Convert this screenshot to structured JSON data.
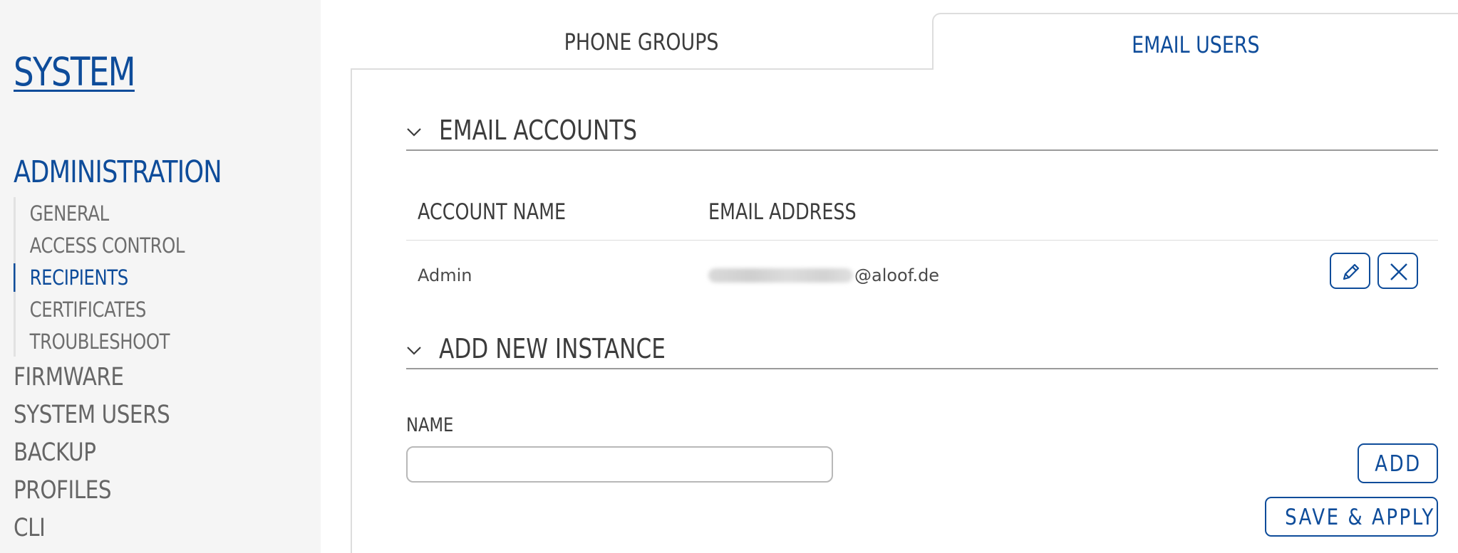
{
  "sidebar": {
    "title": "SYSTEM",
    "section": "ADMINISTRATION",
    "subitems": [
      {
        "label": "GENERAL",
        "active": false
      },
      {
        "label": "ACCESS CONTROL",
        "active": false
      },
      {
        "label": "RECIPIENTS",
        "active": true
      },
      {
        "label": "CERTIFICATES",
        "active": false
      },
      {
        "label": "TROUBLESHOOT",
        "active": false
      }
    ],
    "items": [
      {
        "label": "FIRMWARE"
      },
      {
        "label": "SYSTEM USERS"
      },
      {
        "label": "BACKUP"
      },
      {
        "label": "PROFILES"
      },
      {
        "label": "CLI"
      }
    ]
  },
  "tabs": [
    {
      "label": "PHONE GROUPS",
      "active": false
    },
    {
      "label": "EMAIL USERS",
      "active": true
    }
  ],
  "email_accounts": {
    "title": "EMAIL ACCOUNTS",
    "columns": [
      "ACCOUNT NAME",
      "EMAIL ADDRESS"
    ],
    "rows": [
      {
        "account_name": "Admin",
        "email_address": "@aloof.de"
      }
    ],
    "row_actions": {
      "edit_icon": "pencil-icon",
      "delete_icon": "close-icon"
    }
  },
  "add_instance": {
    "title": "ADD NEW INSTANCE",
    "name_label": "NAME",
    "name_value": "",
    "name_placeholder": "",
    "add_label": "ADD"
  },
  "footer": {
    "save_apply_label": "SAVE & APPLY"
  },
  "colors": {
    "accent": "#0e4c9a",
    "sidebar_bg": "#f5f5f5",
    "border": "#dddddd",
    "text": "#404040"
  }
}
